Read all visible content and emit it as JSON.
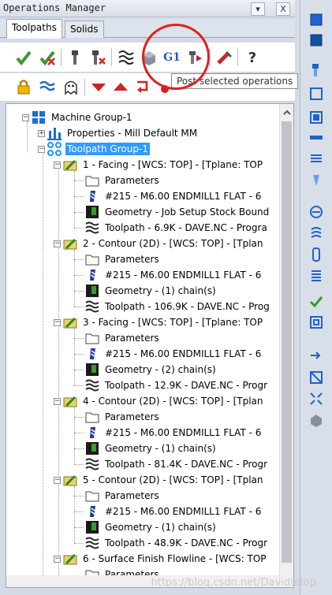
{
  "window": {
    "title": "Operations Manager",
    "pin_glyph": "▾",
    "close_glyph": "X"
  },
  "tabs": [
    {
      "label": "Toolpaths",
      "active": true
    },
    {
      "label": "Solids",
      "active": false
    }
  ],
  "toolbar1": {
    "g1_label": "G1",
    "help_glyph": "?",
    "buttons": [
      "select-all-operations-icon",
      "select-all-dirty-operations-icon",
      "regenerate-selected-icon",
      "regenerate-all-dirty-icon",
      "backplot-icon",
      "verify-icon",
      "post-selected-icon",
      "high-feed-icon",
      "lock-icon",
      "help-icon"
    ]
  },
  "toolbar2": {
    "buttons": [
      "lock-toggle-icon",
      "toolpath-display-icon",
      "ghost-icon",
      "move-down-icon",
      "move-up-icon",
      "insert-arrow-icon",
      "reorder-icon"
    ]
  },
  "tooltip": {
    "text": "Post selected operations"
  },
  "tree": {
    "machine_group": "Machine Group-1",
    "properties": "Properties - Mill Default MM",
    "toolpath_group": "Toolpath Group-1",
    "operations": [
      {
        "title": "1 - Facing - [WCS: TOP] - [Tplane: TOP",
        "params": "Parameters",
        "tool": "#215 - M6.00 ENDMILL1 FLAT -    6",
        "geometry": "Geometry - Job Setup Stock Bound",
        "toolpath": "Toolpath - 6.9K - DAVE.NC - Progra"
      },
      {
        "title": "2 - Contour (2D) - [WCS: TOP] - [Tplan",
        "params": "Parameters",
        "tool": "#215 - M6.00 ENDMILL1 FLAT -    6",
        "geometry": "Geometry - (1) chain(s)",
        "toolpath": "Toolpath - 106.9K - DAVE.NC - Prog"
      },
      {
        "title": "3 - Facing - [WCS: TOP] - [Tplane: TOP",
        "params": "Parameters",
        "tool": "#215 - M6.00 ENDMILL1 FLAT -    6",
        "geometry": "Geometry - (2) chain(s)",
        "toolpath": "Toolpath - 12.9K - DAVE.NC - Progr"
      },
      {
        "title": "4 - Contour (2D) - [WCS: TOP] - [Tplan",
        "params": "Parameters",
        "tool": "#215 - M6.00 ENDMILL1 FLAT -    6",
        "geometry": "Geometry - (1) chain(s)",
        "toolpath": "Toolpath - 81.4K - DAVE.NC - Progr"
      },
      {
        "title": "5 - Contour (2D) - [WCS: TOP] - [Tplan",
        "params": "Parameters",
        "tool": "#215 - M6.00 ENDMILL1 FLAT -    6",
        "geometry": "Geometry - (1) chain(s)",
        "toolpath": "Toolpath - 48.9K - DAVE.NC - Progr"
      }
    ],
    "last_operation": {
      "title": "6 - Surface Finish Flowline - [WCS: TOP",
      "params": "Parameters"
    }
  },
  "watermark": "https://blog.csdn.net/Davidietop",
  "colors": {
    "selection": "#3399ff",
    "highlight_circle": "#e02020",
    "accent_green": "#3a9a2a",
    "accent_red": "#d22"
  }
}
